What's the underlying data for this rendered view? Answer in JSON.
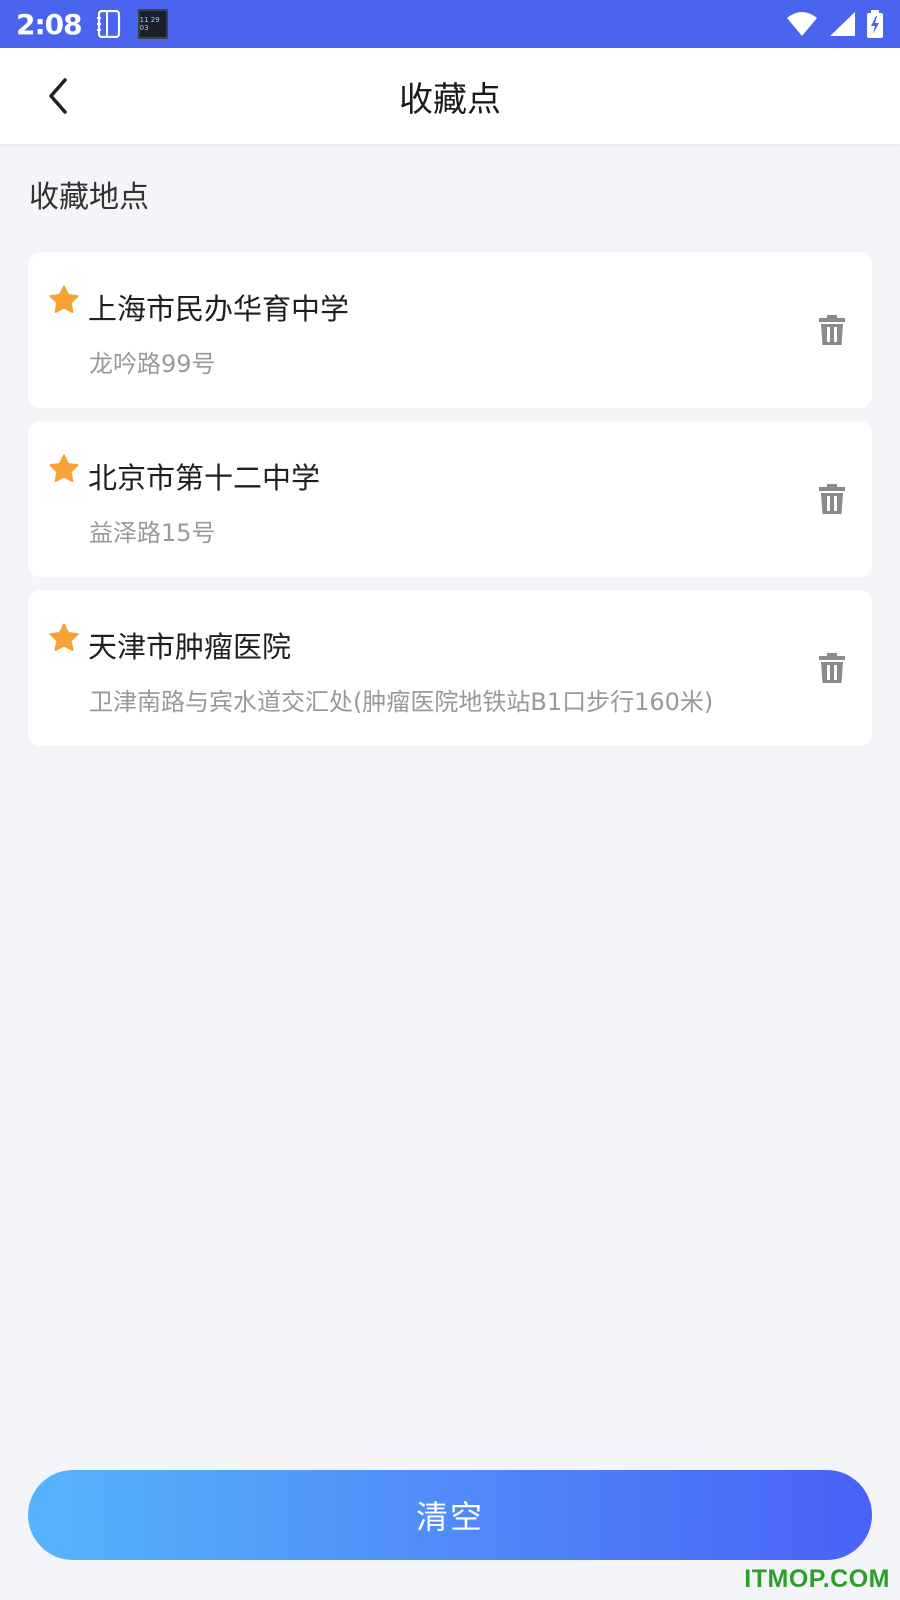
{
  "status_bar": {
    "time": "2:08",
    "app_icon_lines": [
      "11 29 03"
    ]
  },
  "header": {
    "title": "收藏点"
  },
  "section": {
    "title": "收藏地点"
  },
  "favorites": [
    {
      "name": "上海市民办华育中学",
      "address": "龙吟路99号"
    },
    {
      "name": "北京市第十二中学",
      "address": "益泽路15号"
    },
    {
      "name": "天津市肿瘤医院",
      "address": "卫津南路与宾水道交汇处(肿瘤医院地铁站B1口步行160米)"
    }
  ],
  "footer": {
    "clear_label": "清空"
  },
  "watermark": "ITMOP.COM",
  "colors": {
    "status_bar": "#4a64f0",
    "star": "#f7a233",
    "trash": "#8a8a8a",
    "gradient_start": "#56b4fb",
    "gradient_end": "#4a62f7",
    "watermark": "#2aa02a"
  },
  "icons": {
    "back": "chevron-left-icon",
    "star": "star-icon",
    "delete": "trash-icon"
  }
}
